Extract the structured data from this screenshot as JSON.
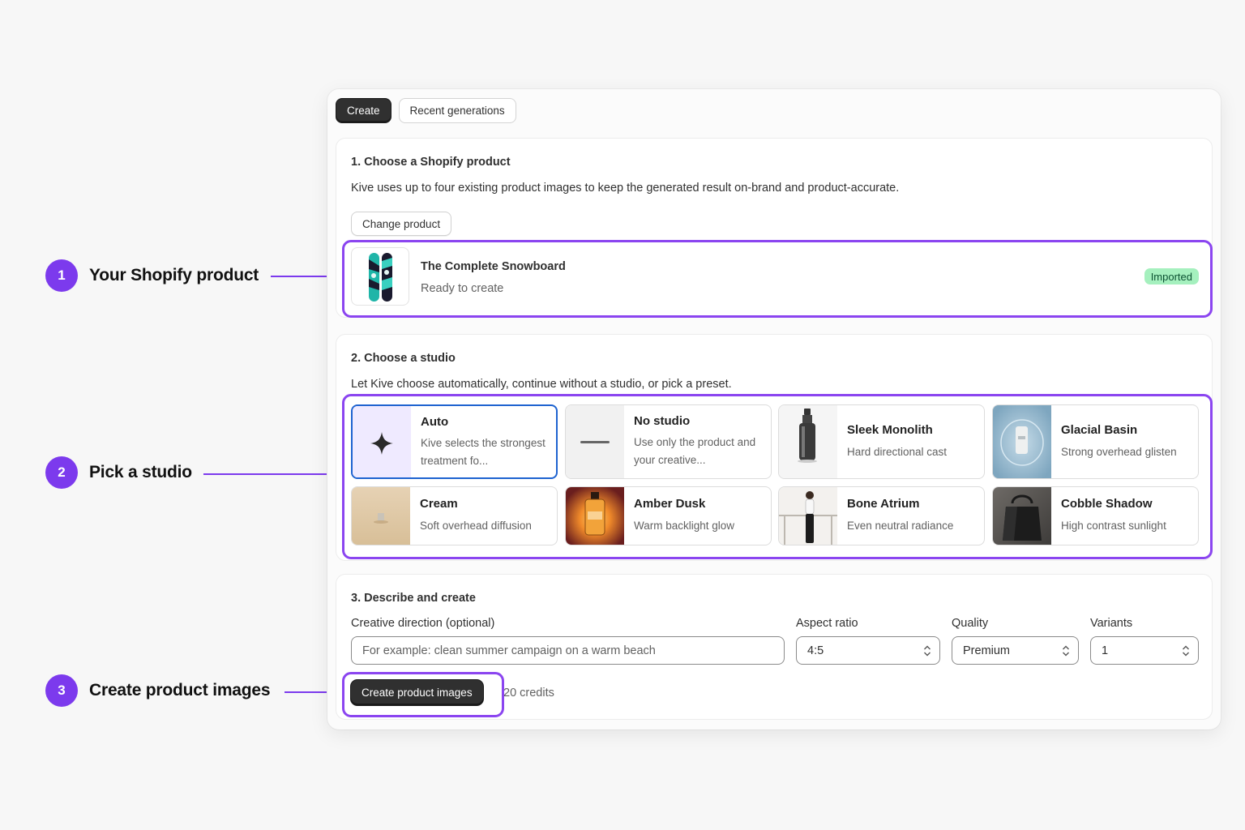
{
  "callouts": [
    {
      "number": "1",
      "label": "Your Shopify product"
    },
    {
      "number": "2",
      "label": "Pick a studio"
    },
    {
      "number": "3",
      "label": "Create product images"
    }
  ],
  "tabs": {
    "create": "Create",
    "recent": "Recent generations"
  },
  "section1": {
    "title": "1. Choose a Shopify product",
    "description": "Kive uses up to four existing product images to keep the generated result on-brand and product-accurate.",
    "change_button": "Change product",
    "product_name": "The Complete Snowboard",
    "product_status": "Ready to create",
    "badge": "Imported"
  },
  "section2": {
    "title": "2. Choose a studio",
    "description": "Let Kive choose automatically, continue without a studio, or pick a preset.",
    "studios": [
      {
        "name": "Auto",
        "desc": "Kive selects the strongest treatment fo...",
        "icon": "sparkle-icon",
        "selected": true
      },
      {
        "name": "No studio",
        "desc": "Use only the product and your creative...",
        "icon": "dash-icon"
      },
      {
        "name": "Sleek Monolith",
        "desc": "Hard directional cast"
      },
      {
        "name": "Glacial Basin",
        "desc": "Strong overhead glisten"
      },
      {
        "name": "Cream",
        "desc": "Soft overhead diffusion"
      },
      {
        "name": "Amber Dusk",
        "desc": "Warm backlight glow"
      },
      {
        "name": "Bone Atrium",
        "desc": "Even neutral radiance"
      },
      {
        "name": "Cobble Shadow",
        "desc": "High contrast sunlight"
      }
    ]
  },
  "section3": {
    "title": "3. Describe and create",
    "direction_label": "Creative direction (optional)",
    "direction_placeholder": "For example: clean summer campaign on a warm beach",
    "aspect_label": "Aspect ratio",
    "aspect_value": "4:5",
    "quality_label": "Quality",
    "quality_value": "Premium",
    "variants_label": "Variants",
    "variants_value": "1",
    "create_button": "Create product images",
    "credits": "20 credits"
  },
  "colors": {
    "accent": "#7c3aed",
    "highlight": "#8b45f0",
    "selected_border": "#1e63d0",
    "badge_bg": "#a5f0be"
  }
}
